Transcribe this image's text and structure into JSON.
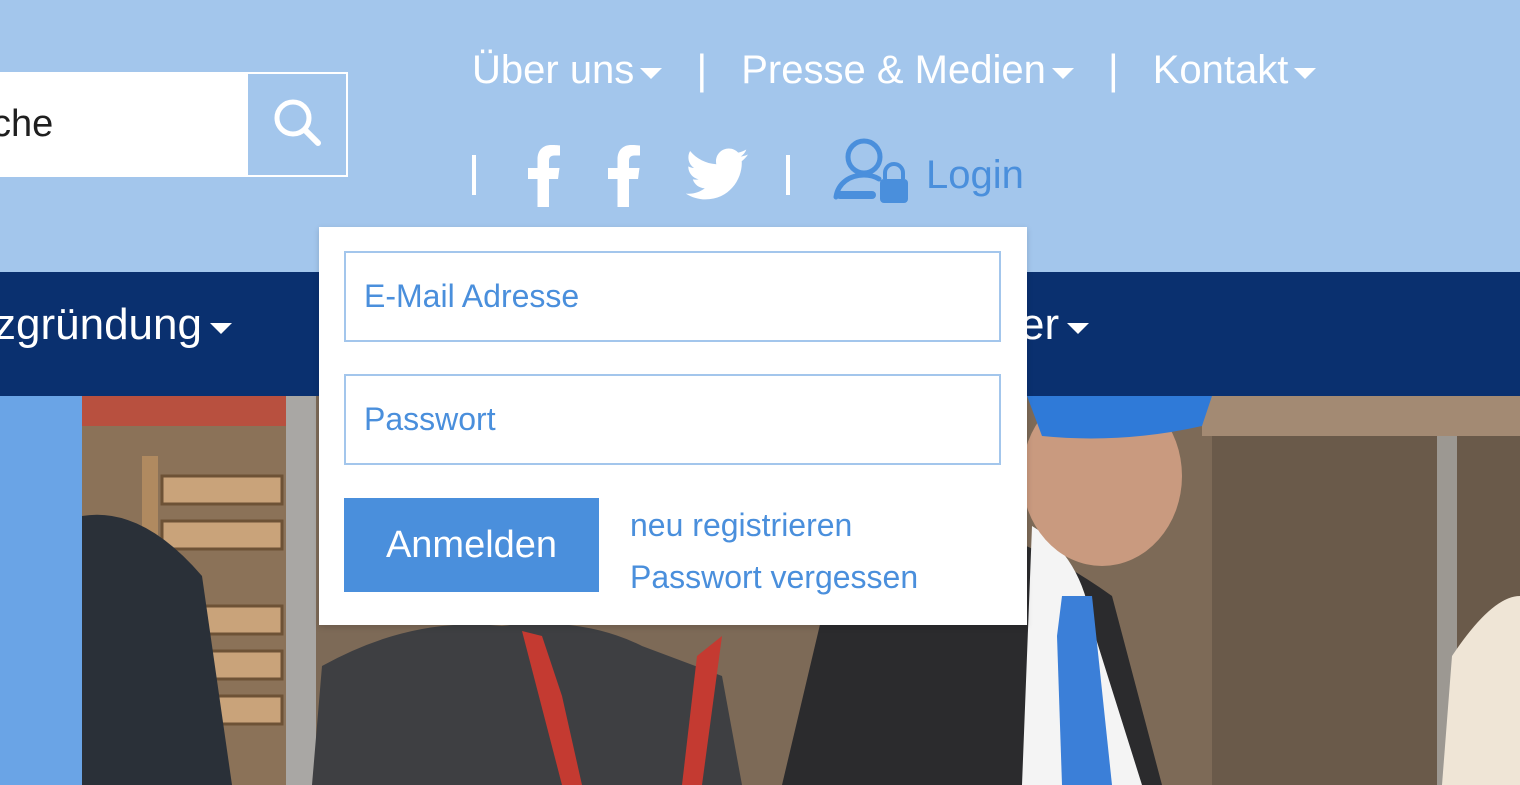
{
  "header": {
    "search": {
      "value": "che",
      "button_icon": "search-icon"
    },
    "top_nav": [
      {
        "label": "Über uns",
        "icon": "caret-down-icon"
      },
      {
        "label": "Presse & Medien",
        "icon": "caret-down-icon"
      },
      {
        "label": "Kontakt",
        "icon": "caret-down-icon"
      }
    ],
    "social": [
      {
        "icon": "facebook-icon"
      },
      {
        "icon": "facebook-icon"
      },
      {
        "icon": "twitter-icon"
      }
    ],
    "login": {
      "label": "Login",
      "icon": "user-lock-icon"
    }
  },
  "main_nav": {
    "items": [
      {
        "label": "zgründung",
        "icon": "caret-down-icon"
      },
      {
        "label": "er",
        "icon": "caret-down-icon"
      }
    ]
  },
  "login_panel": {
    "email_placeholder": "E-Mail Adresse",
    "password_placeholder": "Passwort",
    "submit_label": "Anmelden",
    "register_link": "neu registrieren",
    "forgot_link": "Passwort vergessen"
  },
  "colors": {
    "header_bg": "#a3c6ec",
    "nav_bg": "#0a306f",
    "accent": "#4a8fdc",
    "white": "#ffffff"
  }
}
